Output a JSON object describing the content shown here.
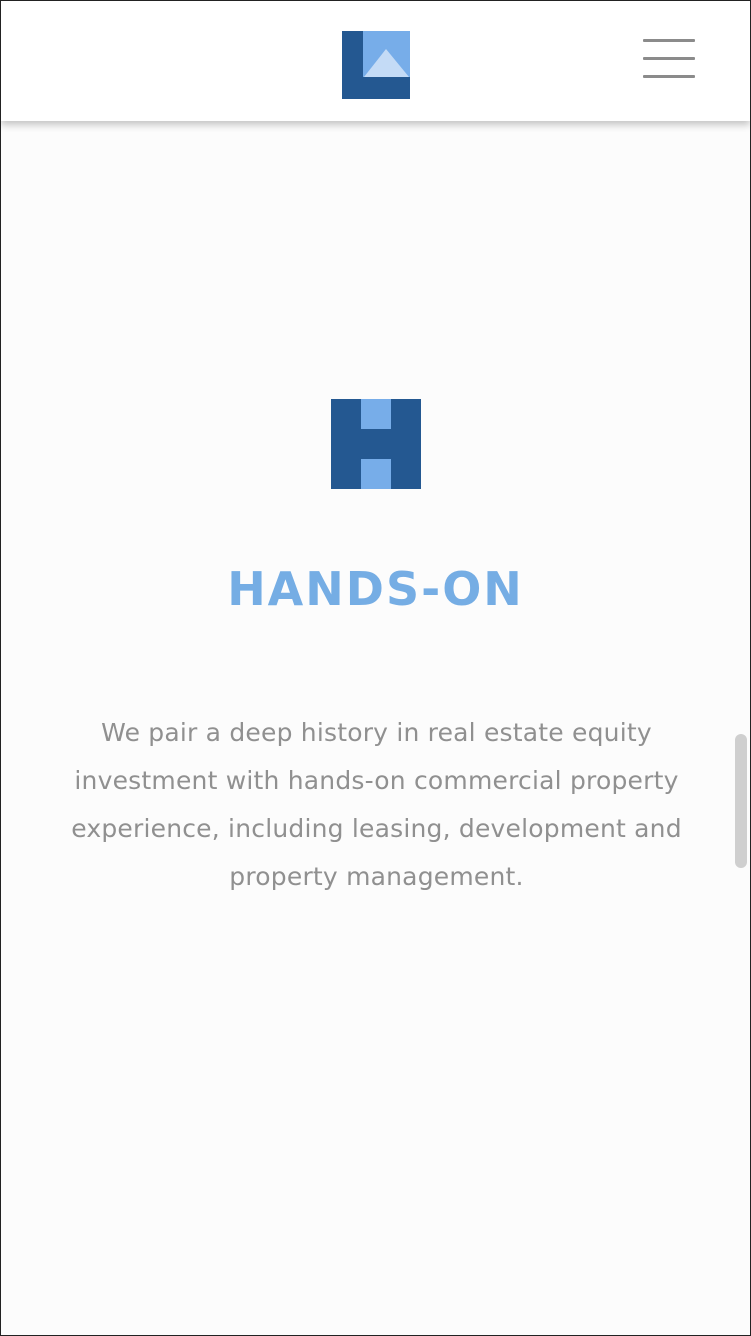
{
  "header": {
    "logo_name": "brand-logo",
    "menu_icon": "hamburger-menu-icon",
    "menu_label": "Menu"
  },
  "feature": {
    "icon": "h-letter-icon",
    "title": "HANDS-ON",
    "description": "We pair a deep history in real estate equity investment with hands-on commercial property experience, including leasing, development and property management."
  },
  "colors": {
    "brand_dark": "#245891",
    "brand_light": "#77ade9",
    "brand_pale": "#c4dbf6",
    "title": "#75ade4",
    "text": "#909090",
    "menu": "#8b8b8b"
  }
}
